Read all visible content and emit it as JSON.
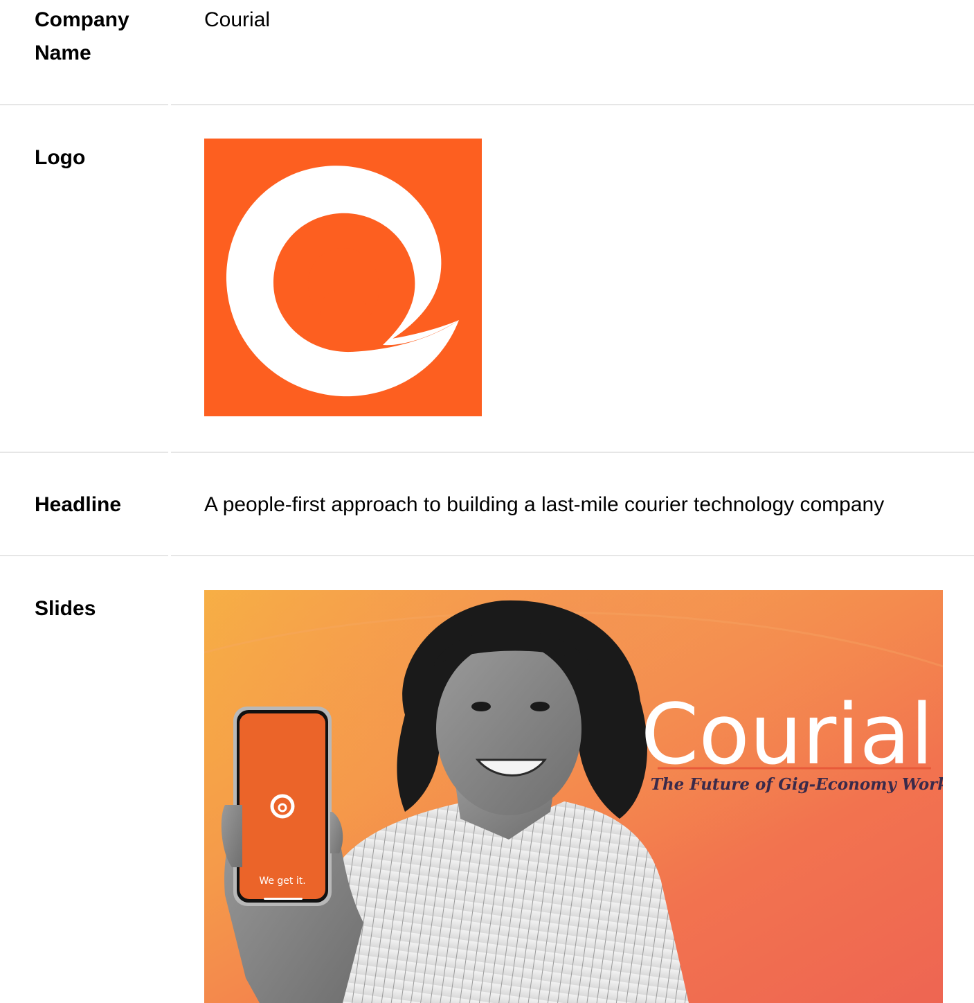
{
  "rows": [
    {
      "label": "Company\nName",
      "value": "Courial"
    },
    {
      "label": "Logo"
    },
    {
      "label": "Headline",
      "value": "A people-first approach to building a last-mile courier technology company"
    },
    {
      "label": "Slides"
    }
  ],
  "slide": {
    "brand": "Courial",
    "tagline": "The Future of Gig-Economy Work",
    "phone_text": "We get it."
  },
  "colors": {
    "brand_orange": "#fd5f20",
    "divider": "#e6e6e6"
  }
}
